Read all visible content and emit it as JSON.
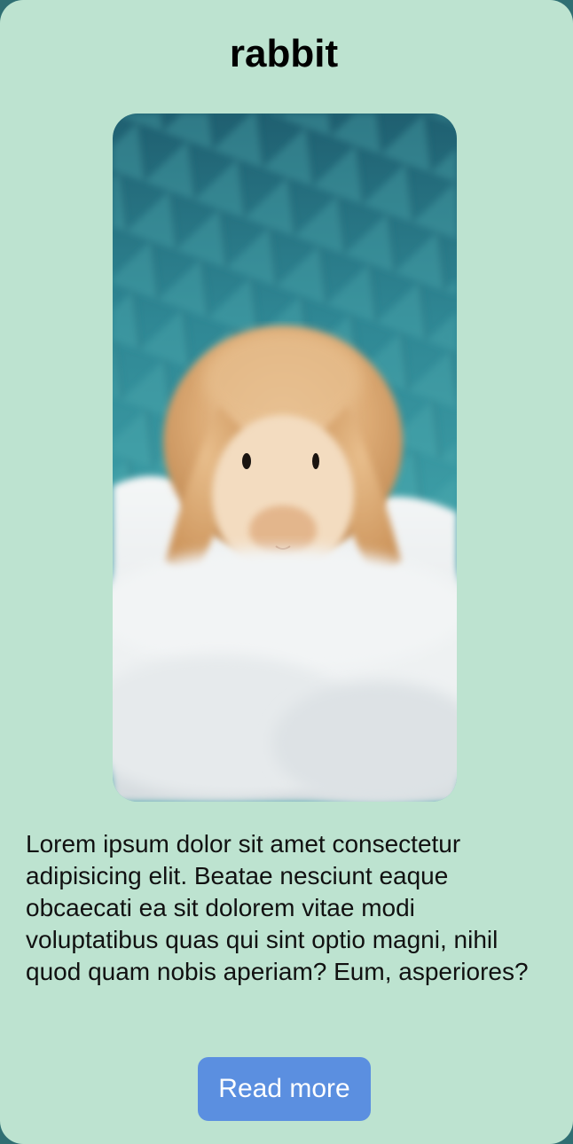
{
  "card": {
    "title": "rabbit",
    "image_subject": "rabbit-photo",
    "description": "Lorem ipsum dolor sit amet consectetur adipisicing elit. Beatae nesciunt eaque obcaecati ea sit dolorem vitae modi voluptatibus quas qui sint optio magni, nihil quod quam nobis aperiam? Eum, asperiores?",
    "button_label": "Read more"
  },
  "colors": {
    "card_background": "#bde3d0",
    "button_background": "#5b8fe0",
    "button_text": "#ffffff"
  }
}
